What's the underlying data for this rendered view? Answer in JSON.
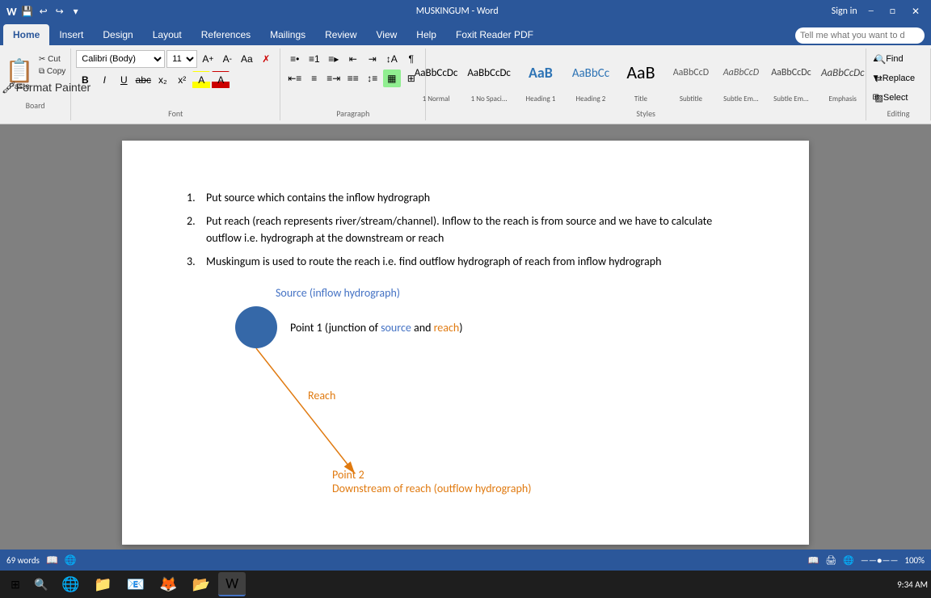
{
  "titlebar": {
    "title": "MUSKINGUM - Word",
    "sign_in": "Sign in",
    "quick_access": [
      "save",
      "undo",
      "redo",
      "customize"
    ]
  },
  "ribbon": {
    "tabs": [
      {
        "label": "Home",
        "active": true
      },
      {
        "label": "Insert",
        "active": false
      },
      {
        "label": "Design",
        "active": false
      },
      {
        "label": "Layout",
        "active": false
      },
      {
        "label": "References",
        "active": false
      },
      {
        "label": "Mailings",
        "active": false
      },
      {
        "label": "Review",
        "active": false
      },
      {
        "label": "View",
        "active": false
      },
      {
        "label": "Help",
        "active": false
      },
      {
        "label": "Foxit Reader PDF",
        "active": false
      }
    ],
    "search_placeholder": "Tell me what you want to d",
    "clipboard": {
      "paste": "Paste",
      "cut": "Cut",
      "copy": "Copy",
      "format_painter": "Format Painter"
    },
    "font": {
      "name": "Calibri (Body)",
      "size": "11",
      "grow": "A↑",
      "shrink": "A↓",
      "change_case": "Aa",
      "clear": "✗",
      "bold": "B",
      "italic": "I",
      "underline": "U",
      "strikethrough": "abc",
      "subscript": "x₂",
      "superscript": "x²",
      "highlight": "A",
      "color": "A"
    },
    "styles": [
      {
        "label": "¶ Normal",
        "name": "1 Normal",
        "active": false
      },
      {
        "label": "¶ No Spaci...",
        "name": "1 No Spaci...",
        "active": false
      },
      {
        "label": "Heading 1",
        "name": "Heading 1",
        "active": false
      },
      {
        "label": "Heading 2",
        "name": "Heading 2",
        "active": false
      },
      {
        "label": "Title",
        "name": "Title",
        "active": false
      },
      {
        "label": "Subtitle",
        "name": "Subtitle",
        "active": false
      },
      {
        "label": "Subtle Em...",
        "name": "Subtle Em...",
        "active": false
      },
      {
        "label": "AaBbCcDc",
        "name": "Subtle Em...",
        "active": false
      },
      {
        "label": "Emphasis",
        "name": "Emphasis",
        "active": false
      }
    ],
    "editing": {
      "find": "Find",
      "replace": "Replace",
      "select": "Select"
    }
  },
  "document": {
    "list_items": [
      "Put source which contains the inflow hydrograph",
      "Put reach (reach represents river/stream/channel). Inflow to the reach is from source and we have to calculate outflow i.e. hydrograph at the downstream or reach",
      "Muskingum is used to route the reach i.e. find outflow hydrograph of reach from inflow hydrograph"
    ],
    "diagram": {
      "source_label": "Source (inflow hydrograph)",
      "point1": "Point 1 (junction of ",
      "source_word": "source",
      "and_word": " and ",
      "reach_word": "reach",
      "point1_end": ")",
      "reach_label": "Reach",
      "point2_label": "Point 2",
      "downstream_label": "Downstream of reach (outflow hydrograph)"
    }
  },
  "status_bar": {
    "word_count": "69 words",
    "view_icons": [
      "read",
      "print",
      "web"
    ],
    "zoom": "100%",
    "time": "9:34 AM"
  },
  "taskbar": {
    "apps": [
      "⊞",
      "🌐",
      "📁",
      "📄",
      "📊",
      "📝",
      "🔵"
    ],
    "time": "9:34 AM"
  }
}
